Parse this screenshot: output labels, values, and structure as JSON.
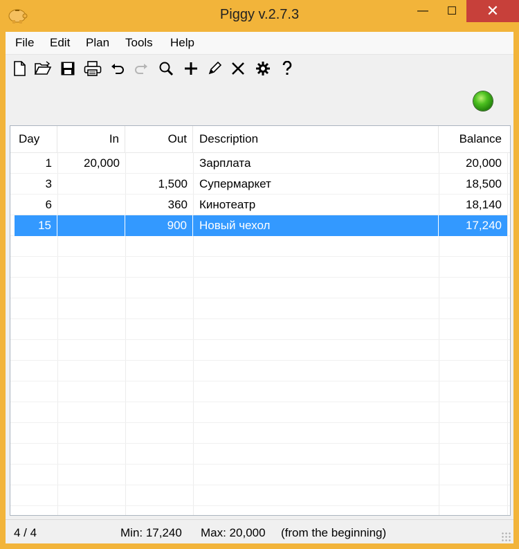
{
  "window": {
    "title": "Piggy v.2.7.3",
    "controls": {
      "minimize": "—",
      "maximize": "☐",
      "close": "✕"
    }
  },
  "menu": [
    "File",
    "Edit",
    "Plan",
    "Tools",
    "Help"
  ],
  "toolbar": {
    "icons": [
      "new-file-icon",
      "open-folder-icon",
      "save-icon",
      "print-icon",
      "undo-icon",
      "redo-icon",
      "search-icon",
      "add-icon",
      "edit-pencil-icon",
      "delete-icon",
      "settings-gear-icon",
      "help-icon"
    ]
  },
  "status_indicator": {
    "color": "#3cb41c"
  },
  "table": {
    "columns": [
      "Day",
      "In",
      "Out",
      "Description",
      "Balance"
    ],
    "rows": [
      {
        "day": "1",
        "in": "20,000",
        "out": "",
        "description": "Зарплата",
        "balance": "20,000"
      },
      {
        "day": "3",
        "in": "",
        "out": "1,500",
        "description": "Супермаркет",
        "balance": "18,500"
      },
      {
        "day": "6",
        "in": "",
        "out": "360",
        "description": "Кинотеатр",
        "balance": "18,140"
      },
      {
        "day": "15",
        "in": "",
        "out": "900",
        "description": "Новый чехол",
        "balance": "17,240"
      }
    ],
    "selected_row": 3
  },
  "status": {
    "count": "4 / 4",
    "min": "Min: 17,240",
    "max": "Max: 20,000",
    "range": "(from the beginning)"
  },
  "colors": {
    "selection": "#3399ff",
    "title_bar": "#f2b43a",
    "close_button": "#c7403a"
  }
}
